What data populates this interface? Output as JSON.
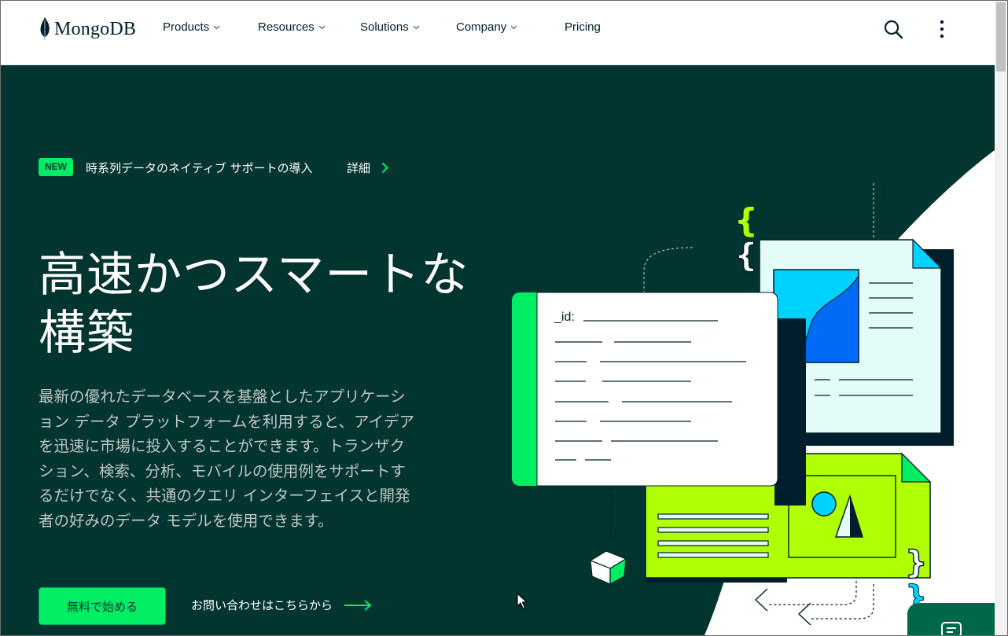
{
  "header": {
    "logo_text": "MongoDB",
    "nav": [
      {
        "label": "Products",
        "has_dropdown": true
      },
      {
        "label": "Resources",
        "has_dropdown": true
      },
      {
        "label": "Solutions",
        "has_dropdown": true
      },
      {
        "label": "Company",
        "has_dropdown": true
      },
      {
        "label": "Pricing",
        "has_dropdown": false
      }
    ],
    "icons": [
      "search-icon",
      "kebab-menu-icon"
    ]
  },
  "announcement": {
    "badge": "NEW",
    "text": "時系列データのネイティブ サポートの導入",
    "link": "詳細"
  },
  "hero": {
    "title": "高速かつスマートな構築",
    "body": "最新の優れたデータベースを基盤としたアプリケーション データ プラットフォームを利用すると、アイデアを迅速に市場に投入することができます。トランザクション、検索、分析、モバイルの使用例をサポートするだけでなく、共通のクエリ インターフェイスと開発者の好みのデータ モデルを使用できます。",
    "primary_cta": "無料で始める",
    "secondary_cta": "お問い合わせはこちらから"
  },
  "illustration": {
    "document_field": "_id:"
  },
  "colors": {
    "brand_green": "#00ed64",
    "hero_bg": "#023430",
    "dark_text": "#001e2b",
    "lime": "#b1ff05",
    "cyan": "#00d2ff",
    "blue": "#016bf8"
  }
}
